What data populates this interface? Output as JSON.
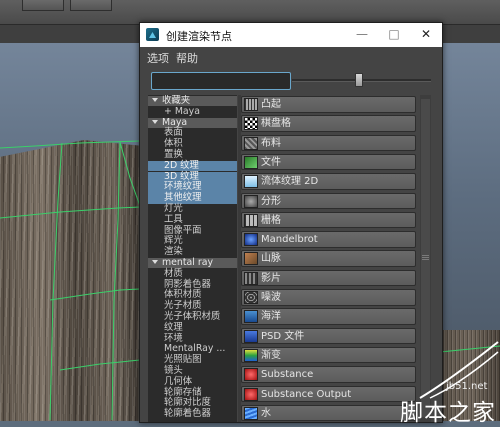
{
  "window": {
    "title": "创建渲染节点",
    "minimize": "—",
    "maximize": "□",
    "close": "✕"
  },
  "menu": {
    "options": "选项",
    "help": "帮助"
  },
  "search": {
    "value": ""
  },
  "tree": [
    {
      "label": "收藏夹",
      "type": "header",
      "expand": true
    },
    {
      "label": "+ Maya",
      "type": "item"
    },
    {
      "label": "Maya",
      "type": "header",
      "expand": true
    },
    {
      "label": "表面",
      "type": "item"
    },
    {
      "label": "体积",
      "type": "item"
    },
    {
      "label": "置换",
      "type": "item"
    },
    {
      "label": "2D 纹理",
      "type": "selected"
    },
    {
      "label": "3D 纹理",
      "type": "selected"
    },
    {
      "label": "环境纹理",
      "type": "selected"
    },
    {
      "label": "其他纹理",
      "type": "selected"
    },
    {
      "label": "灯光",
      "type": "item"
    },
    {
      "label": "工具",
      "type": "item"
    },
    {
      "label": "图像平面",
      "type": "item"
    },
    {
      "label": "辉光",
      "type": "item"
    },
    {
      "label": "渲染",
      "type": "item"
    },
    {
      "label": "mental ray",
      "type": "header",
      "expand": true
    },
    {
      "label": "材质",
      "type": "item"
    },
    {
      "label": "阴影着色器",
      "type": "item"
    },
    {
      "label": "体积材质",
      "type": "item"
    },
    {
      "label": "光子材质",
      "type": "item"
    },
    {
      "label": "光子体积材质",
      "type": "item"
    },
    {
      "label": "纹理",
      "type": "item"
    },
    {
      "label": "环境",
      "type": "item"
    },
    {
      "label": "MentalRay ...",
      "type": "item"
    },
    {
      "label": "光照贴图",
      "type": "item"
    },
    {
      "label": "镜头",
      "type": "item"
    },
    {
      "label": "几何体",
      "type": "item"
    },
    {
      "label": "轮廓存储",
      "type": "item"
    },
    {
      "label": "轮廓对比度",
      "type": "item"
    },
    {
      "label": "轮廓着色器",
      "type": "item"
    }
  ],
  "nodes": [
    {
      "label": "凸起",
      "icon": "bump-icon",
      "color": "#9a9a9a"
    },
    {
      "label": "棋盘格",
      "icon": "checker-icon",
      "color": "#ffffff"
    },
    {
      "label": "布料",
      "icon": "cloth-icon",
      "color": "#8a8a8a"
    },
    {
      "label": "文件",
      "icon": "file-icon",
      "color": "#3b8f3b"
    },
    {
      "label": "流体纹理 2D",
      "icon": "fluid-texture-icon",
      "color": "#9fd3f0"
    },
    {
      "label": "分形",
      "icon": "fractal-icon",
      "color": "#7b7b7b"
    },
    {
      "label": "栅格",
      "icon": "grid-icon",
      "color": "#a0a0a0"
    },
    {
      "label": "Mandelbrot",
      "icon": "mandelbrot-icon",
      "color": "#2a4fb0"
    },
    {
      "label": "山脉",
      "icon": "mountain-icon",
      "color": "#8a6a4a"
    },
    {
      "label": "影片",
      "icon": "movie-icon",
      "color": "#5a5a5a"
    },
    {
      "label": "噪波",
      "icon": "noise-icon",
      "color": "#6a6a6a"
    },
    {
      "label": "海洋",
      "icon": "ocean-icon",
      "color": "#2a6ab0"
    },
    {
      "label": "PSD 文件",
      "icon": "psd-file-icon",
      "color": "#2a5ac0"
    },
    {
      "label": "渐变",
      "icon": "ramp-icon",
      "color": "#2aa040"
    },
    {
      "label": "Substance",
      "icon": "substance-icon",
      "color": "#d03030"
    },
    {
      "label": "Substance Output",
      "icon": "substance-output-icon",
      "color": "#d03030"
    },
    {
      "label": "水",
      "icon": "water-icon",
      "color": "#3a7ad0"
    }
  ],
  "watermark": {
    "url": "jb51.net",
    "text": "脚本之家"
  }
}
